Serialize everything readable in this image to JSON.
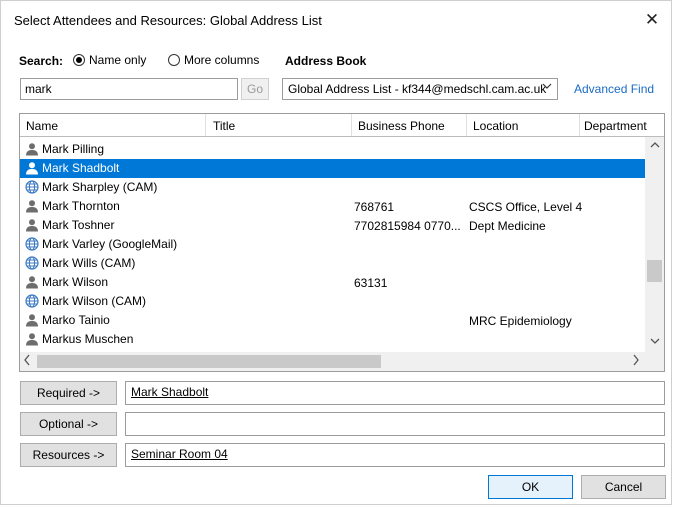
{
  "dialog": {
    "title": "Select Attendees and Resources: Global Address List",
    "close_glyph": "✕"
  },
  "search": {
    "label": "Search:",
    "option_name_only": "Name only",
    "option_more_columns": "More columns",
    "selected_option": "Name only",
    "input_value": "mark",
    "go_label": "Go"
  },
  "address_book": {
    "label": "Address Book",
    "selected": "Global Address List - kf344@medschl.cam.ac.uk",
    "advanced_find": "Advanced Find"
  },
  "list": {
    "columns": [
      "Name",
      "Title",
      "Business Phone",
      "Location",
      "Department"
    ],
    "rows": [
      {
        "name": "Mark Pilling",
        "icon": "person-icon",
        "phone": "",
        "location": ""
      },
      {
        "name": "Mark Shadbolt",
        "icon": "person-icon",
        "phone": "",
        "location": "",
        "selected": true
      },
      {
        "name": "Mark Sharpley (CAM)",
        "icon": "external-contact-icon",
        "phone": "",
        "location": ""
      },
      {
        "name": "Mark Thornton",
        "icon": "person-icon",
        "phone": "768761",
        "location": "CSCS Office, Level 4"
      },
      {
        "name": "Mark Toshner",
        "icon": "person-icon",
        "phone": "7702815984 0770...",
        "location": "Dept Medicine"
      },
      {
        "name": "Mark Varley (GoogleMail)",
        "icon": "external-contact-icon",
        "phone": "",
        "location": ""
      },
      {
        "name": "Mark Wills (CAM)",
        "icon": "external-contact-icon",
        "phone": "",
        "location": ""
      },
      {
        "name": "Mark Wilson",
        "icon": "person-icon",
        "phone": "63131",
        "location": ""
      },
      {
        "name": "Mark Wilson (CAM)",
        "icon": "external-contact-icon",
        "phone": "",
        "location": ""
      },
      {
        "name": "Marko Tainio",
        "icon": "person-icon",
        "phone": "",
        "location": "MRC Epidemiology"
      },
      {
        "name": "Markus Muschen",
        "icon": "person-icon",
        "phone": "",
        "location": ""
      }
    ]
  },
  "recipients": {
    "required_label": "Required ->",
    "required_value": "Mark Shadbolt",
    "optional_label": "Optional ->",
    "optional_value": "",
    "resources_label": "Resources ->",
    "resources_value": "Seminar Room 04"
  },
  "buttons": {
    "ok": "OK",
    "cancel": "Cancel"
  },
  "colors": {
    "selection": "#0078d7",
    "link": "#1a6bc4",
    "person_icon": "#6d6d6d",
    "external_icon": "#3a78c2"
  }
}
